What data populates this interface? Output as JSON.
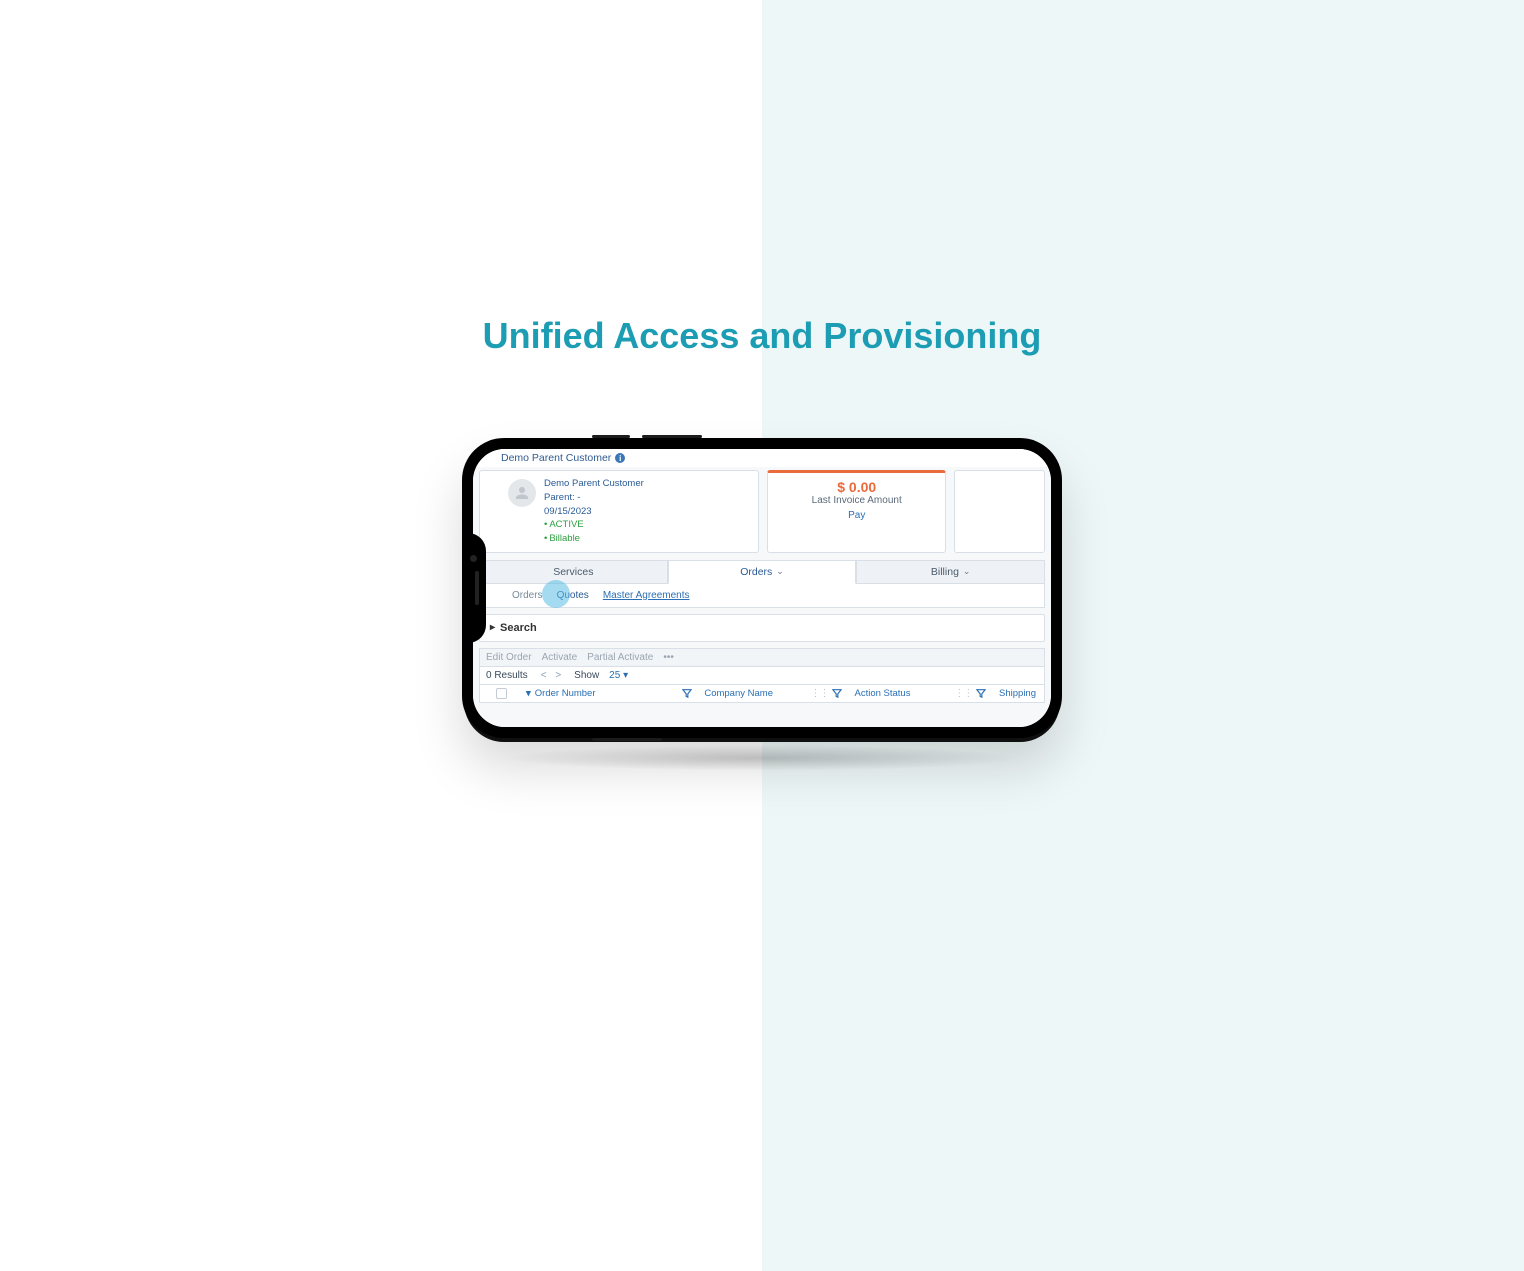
{
  "headline": "Unified Access and Provisioning",
  "titlebar": {
    "customer_name": "Demo Parent Customer"
  },
  "customer_card": {
    "name": "Demo Parent Customer",
    "parent_line": "Parent: -",
    "date": "09/15/2023",
    "status_active": "ACTIVE",
    "status_billable": "Billable"
  },
  "invoice_card": {
    "amount": "$ 0.00",
    "label": "Last Invoice Amount",
    "pay": "Pay"
  },
  "main_tabs": {
    "services": "Services",
    "orders": "Orders",
    "billing": "Billing"
  },
  "sub_tabs": {
    "orders": "Orders",
    "quotes": "Quotes",
    "master_agreements": "Master Agreements"
  },
  "search": {
    "label": "Search"
  },
  "toolbar": {
    "edit_order": "Edit Order",
    "activate": "Activate",
    "partial_activate": "Partial Activate",
    "more": "•••"
  },
  "pager": {
    "results": "0 Results",
    "prev": "<",
    "next": ">",
    "show_label": "Show",
    "show_value": "25"
  },
  "columns": {
    "order_number": "Order Number",
    "company_name": "Company Name",
    "action_status": "Action Status",
    "shipping": "Shipping"
  }
}
